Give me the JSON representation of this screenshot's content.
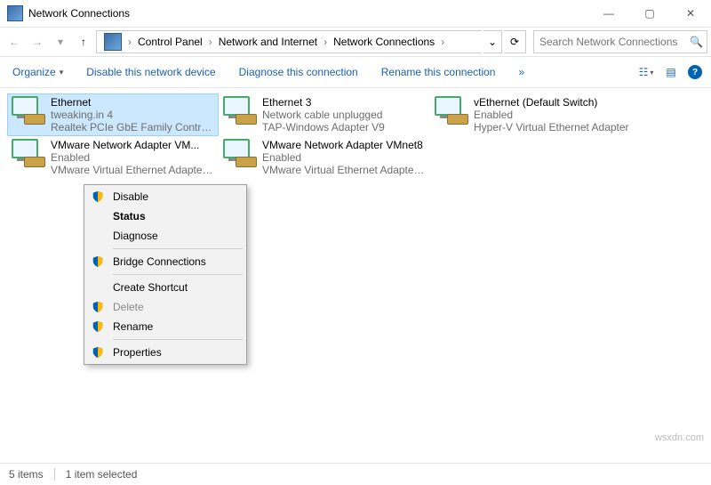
{
  "window": {
    "title": "Network Connections"
  },
  "titlebuttons": {
    "min": "—",
    "max": "▢",
    "close": "✕"
  },
  "nav": {
    "back": "←",
    "forward": "→",
    "dropdown": "▾",
    "up": "↑",
    "crumb1": "Control Panel",
    "crumb2": "Network and Internet",
    "crumb3": "Network Connections",
    "refresh": "⟳",
    "addrdrop": "⌄",
    "search_placeholder": "Search Network Connections",
    "search_icon": "🔍"
  },
  "toolbar": {
    "organize": "Organize",
    "organize_arrow": "▾",
    "disable": "Disable this network device",
    "diagnose": "Diagnose this connection",
    "rename": "Rename this connection",
    "more": "»",
    "view_icon": "☷",
    "view_arrow": "▾",
    "details_icon": "▤",
    "help": "?"
  },
  "adapters": {
    "a0": {
      "name": "Ethernet",
      "l2": "tweaking.in 4",
      "l3": "Realtek PCIe GbE Family Controller"
    },
    "a1": {
      "name": "Ethernet 3",
      "l2": "Network cable unplugged",
      "l3": "TAP-Windows Adapter V9"
    },
    "a2": {
      "name": "vEthernet (Default Switch)",
      "l2": "Enabled",
      "l3": "Hyper-V Virtual Ethernet Adapter"
    },
    "a3": {
      "name": "VMware Network Adapter VM...",
      "l2": "Enabled",
      "l3": "VMware Virtual Ethernet Adapter ..."
    },
    "a4": {
      "name": "VMware Network Adapter VMnet8",
      "l2": "Enabled",
      "l3": "VMware Virtual Ethernet Adapter ..."
    }
  },
  "menu": {
    "disable": "Disable",
    "status": "Status",
    "diagnose": "Diagnose",
    "bridge": "Bridge Connections",
    "shortcut": "Create Shortcut",
    "delete": "Delete",
    "rename": "Rename",
    "properties": "Properties"
  },
  "status": {
    "count": "5 items",
    "selected": "1 item selected"
  },
  "watermark": "wsxdn.com"
}
